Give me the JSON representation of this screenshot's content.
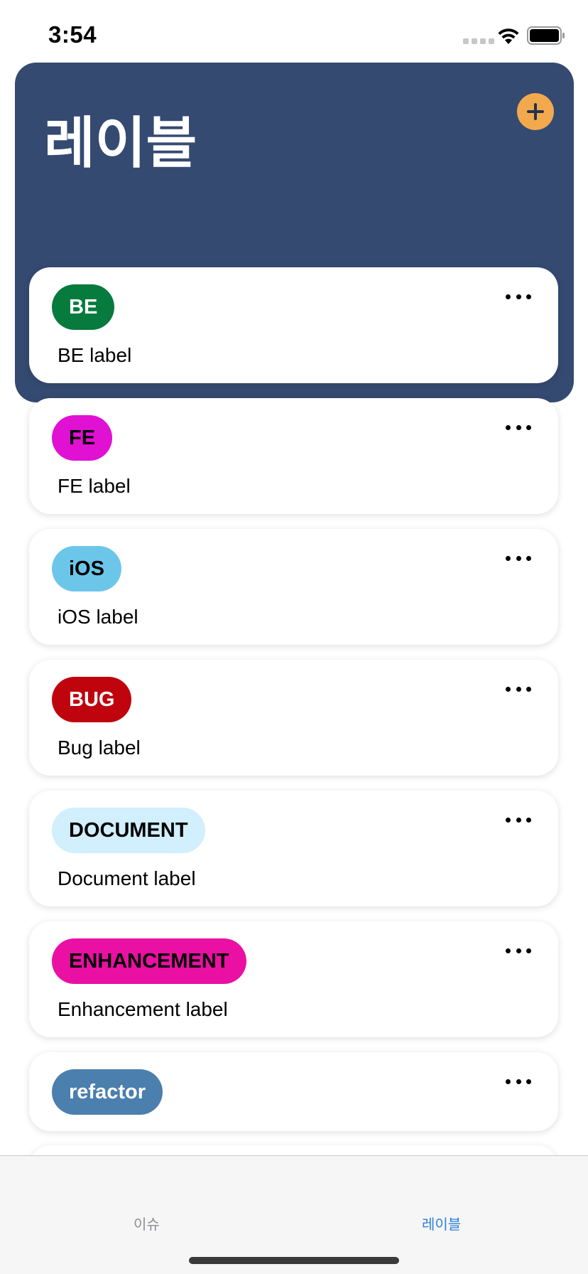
{
  "status_bar": {
    "time": "3:54"
  },
  "header": {
    "title": "레이블",
    "add_icon": "plus-icon",
    "bg_color": "#354a71",
    "add_color": "#f2a94e"
  },
  "labels": [
    {
      "tag": "BE",
      "description": "BE label",
      "tag_bg": "#077a3e",
      "tag_fg": "#ffffff"
    },
    {
      "tag": "FE",
      "description": "FE label",
      "tag_bg": "#e011d3",
      "tag_fg": "#000000"
    },
    {
      "tag": "iOS",
      "description": "iOS label",
      "tag_bg": "#6cc6ea",
      "tag_fg": "#000000"
    },
    {
      "tag": "BUG",
      "description": "Bug label",
      "tag_bg": "#bf040e",
      "tag_fg": "#ffffff"
    },
    {
      "tag": "DOCUMENT",
      "description": "Document label",
      "tag_bg": "#d1effc",
      "tag_fg": "#000000"
    },
    {
      "tag": "ENHANCEMENT",
      "description": "Enhancement label",
      "tag_bg": "#ea10a3",
      "tag_fg": "#000000"
    },
    {
      "tag": "refactor",
      "description": "",
      "tag_bg": "#4a7fae",
      "tag_fg": "#ffffff"
    }
  ],
  "tab_bar": {
    "items": [
      {
        "label": "이슈",
        "selected": false
      },
      {
        "label": "레이블",
        "selected": true
      }
    ],
    "accent": "#2d7fd9"
  }
}
